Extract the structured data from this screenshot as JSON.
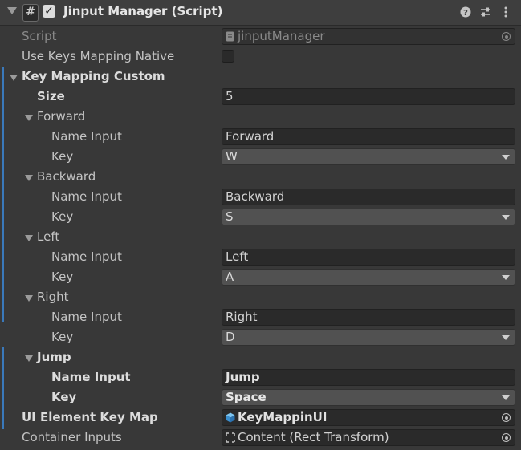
{
  "header": {
    "hash_glyph": "#",
    "title": "Jinput Manager (Script)",
    "help_glyph": "?",
    "preset_glyph": "⇄",
    "more_glyph": "⋮"
  },
  "script": {
    "label": "Script",
    "value": "jinputManager"
  },
  "native": {
    "label": "Use Keys Mapping Native",
    "checked": false
  },
  "custom": {
    "label": "Key Mapping Custom",
    "size_label": "Size",
    "size": "5"
  },
  "entries": [
    {
      "name": "Forward",
      "name_input_label": "Name Input",
      "name_input": "Forward",
      "key_label": "Key",
      "key": "W"
    },
    {
      "name": "Backward",
      "name_input_label": "Name Input",
      "name_input": "Backward",
      "key_label": "Key",
      "key": "S"
    },
    {
      "name": "Left",
      "name_input_label": "Name Input",
      "name_input": "Left",
      "key_label": "Key",
      "key": "A"
    },
    {
      "name": "Right",
      "name_input_label": "Name Input",
      "name_input": "Right",
      "key_label": "Key",
      "key": "D"
    },
    {
      "name": "Jump",
      "name_input_label": "Name Input",
      "name_input": "Jump",
      "key_label": "Key",
      "key": "Space"
    }
  ],
  "ui_element": {
    "label": "UI Element Key Map",
    "value": "KeyMappinUI"
  },
  "container": {
    "label": "Container Inputs",
    "value": "Content (Rect Transform)"
  },
  "colors": {
    "accent_bar": "#3a79bb",
    "prefab_icon": "#4aa3e0",
    "background": "#383838"
  }
}
